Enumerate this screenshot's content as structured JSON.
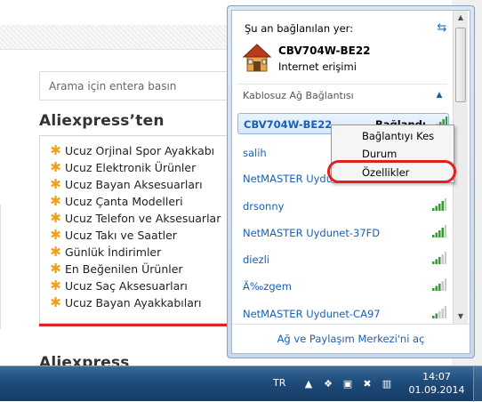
{
  "webpage": {
    "search_placeholder": "Arama için entera basın",
    "section_title": "Aliexpress’ten",
    "section_title_2": "Aliexpress",
    "links": [
      "Ucuz Orjinal Spor Ayakkabı",
      "Ucuz Elektronik Ürünler",
      "Ucuz Bayan Aksesuarları",
      "Ucuz Çanta Modelleri",
      "Ucuz Telefon ve Aksesuarlar",
      "Ucuz Takı ve Saatler",
      "Günlük İndirimler",
      "En Beğenilen Ürünler",
      "Ucuz Saç Aksesuarları",
      "Ucuz Bayan Ayakkabıları"
    ]
  },
  "network_flyout": {
    "header": "Şu an bağlanılan yer:",
    "current_network": {
      "name": "CBV704W-BE22",
      "status": "Internet erişimi"
    },
    "wireless_section_title": "Kablosuz Ağ Bağlantısı",
    "networks": [
      {
        "name": "CBV704W-BE22",
        "status": "Bağlandı",
        "selected": true
      },
      {
        "name": "salih",
        "status": ""
      },
      {
        "name": "NetMASTER Uydun",
        "status": ""
      },
      {
        "name": "drsonny",
        "status": ""
      },
      {
        "name": "NetMASTER Uydunet-37FD",
        "status": ""
      },
      {
        "name": "diezli",
        "status": ""
      },
      {
        "name": "Ã‰zgem",
        "status": ""
      },
      {
        "name": "NetMASTER Uydunet-CA97",
        "status": ""
      }
    ],
    "footer_link": "Ağ ve Paylaşım Merkezi'ni aç"
  },
  "context_menu": {
    "items": [
      "Bağlantıyı Kes",
      "Durum",
      "Özellikler"
    ],
    "highlighted_item": "Özellikler"
  },
  "taskbar": {
    "language": "TR",
    "time": "14:07",
    "date": "01.09.2014"
  },
  "colors": {
    "link_star": "#f2a01a",
    "accent_red": "#d9262b",
    "network_link": "#1a5fb4",
    "signal_green": "#2e9e2e",
    "taskbar": "#1d4b7a"
  }
}
